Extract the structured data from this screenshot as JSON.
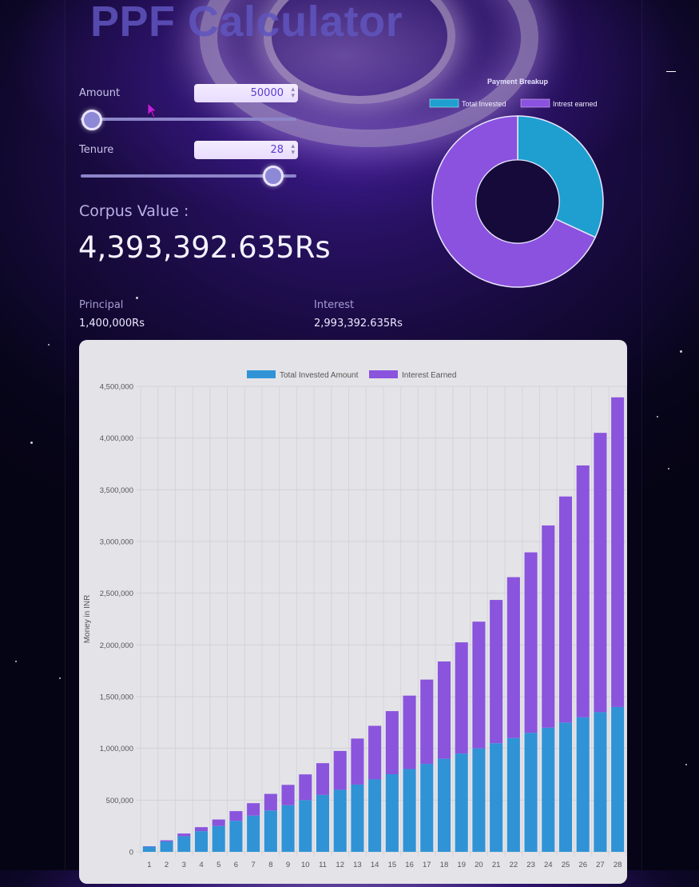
{
  "page": {
    "title": "PPF Calculator"
  },
  "inputs": {
    "amount": {
      "label": "Amount",
      "value": "50000",
      "slider_fraction": 0.0
    },
    "tenure": {
      "label": "Tenure",
      "value": "28",
      "slider_fraction": 0.92
    }
  },
  "results": {
    "corpus_label": "Corpus Value :",
    "corpus_value": "4,393,392.635Rs",
    "principal_label": "Principal",
    "principal_value": "1,400,000Rs",
    "interest_label": "Interest",
    "interest_value": "2,993,392.635Rs"
  },
  "colors": {
    "invested": "#2f93d6",
    "interest": "#8a54dd",
    "donut_invested": "#1e9fd0",
    "donut_interest": "#8a52de",
    "accent": "#5b3bd1"
  },
  "chart_data": [
    {
      "type": "pie",
      "title": "Payment Breakup",
      "legend_placement": "top",
      "labels": [
        "Total Invested",
        "Intrest earned"
      ],
      "values": [
        1400000,
        2993392.635
      ],
      "donut": true
    },
    {
      "type": "bar",
      "stacked": true,
      "legend_placement": "top",
      "ylabel": "Money in INR",
      "xlabel": "",
      "ylim": [
        0,
        4500000
      ],
      "yticks": [
        0,
        500000,
        1000000,
        1500000,
        2000000,
        2500000,
        3000000,
        3500000,
        4000000,
        4500000
      ],
      "ytick_labels": [
        "0",
        "500,000",
        "1,000,000",
        "1,500,000",
        "2,000,000",
        "2,500,000",
        "3,000,000",
        "3,500,000",
        "4,000,000",
        "4,500,000"
      ],
      "grid": true,
      "categories": [
        "1",
        "2",
        "3",
        "4",
        "5",
        "6",
        "7",
        "8",
        "9",
        "10",
        "11",
        "12",
        "13",
        "14",
        "15",
        "16",
        "17",
        "18",
        "19",
        "20",
        "21",
        "22",
        "23",
        "24",
        "25",
        "26",
        "27",
        "28"
      ],
      "series": [
        {
          "name": "Total Invested Amount",
          "values": [
            50000,
            100000,
            150000,
            200000,
            250000,
            300000,
            350000,
            400000,
            450000,
            500000,
            550000,
            600000,
            650000,
            700000,
            750000,
            800000,
            850000,
            900000,
            950000,
            1000000,
            1050000,
            1100000,
            1150000,
            1200000,
            1250000,
            1300000,
            1350000,
            1400000
          ]
        },
        {
          "name": "Interest Earned",
          "values": [
            3550,
            11360,
            26840,
            38350,
            62280,
            93380,
            120100,
            160190,
            197200,
            248600,
            307000,
            375000,
            445000,
            518000,
            610000,
            710000,
            815000,
            940000,
            1075000,
            1225000,
            1385000,
            1555000,
            1745000,
            1955000,
            2185000,
            2435000,
            2700000,
            2993393
          ]
        }
      ]
    }
  ]
}
